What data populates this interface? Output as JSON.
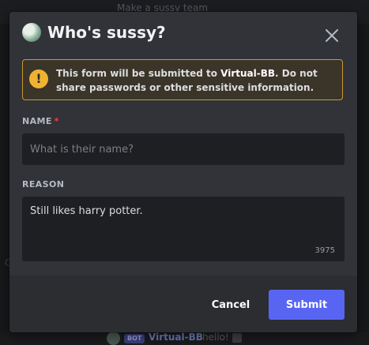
{
  "background": {
    "top_text": "Make a sussy team",
    "left_glyph": "C",
    "message": {
      "badge": "BOT",
      "author": "Virtual-BB",
      "text": "hello!"
    }
  },
  "modal": {
    "title": "Who's sussy?",
    "warning": {
      "prefix": "This form will be submitted to ",
      "app_name": "Virtual-BB",
      "suffix": ". Do not share passwords or other sensitive information."
    },
    "fields": {
      "name": {
        "label": "Name",
        "required_marker": "*",
        "placeholder": "What is their name?",
        "value": ""
      },
      "reason": {
        "label": "Reason",
        "value": "Still likes harry potter.",
        "remaining_chars": "3975"
      }
    },
    "footer": {
      "cancel_label": "Cancel",
      "submit_label": "Submit"
    }
  },
  "colors": {
    "accent": "#5865f2",
    "warning": "#f0b232",
    "required": "#f23f43",
    "modal_bg": "#313338",
    "footer_bg": "#2b2d31"
  },
  "icons": {
    "close": "close-icon",
    "warning": "warning-icon",
    "app_avatar": "app-avatar-icon"
  }
}
